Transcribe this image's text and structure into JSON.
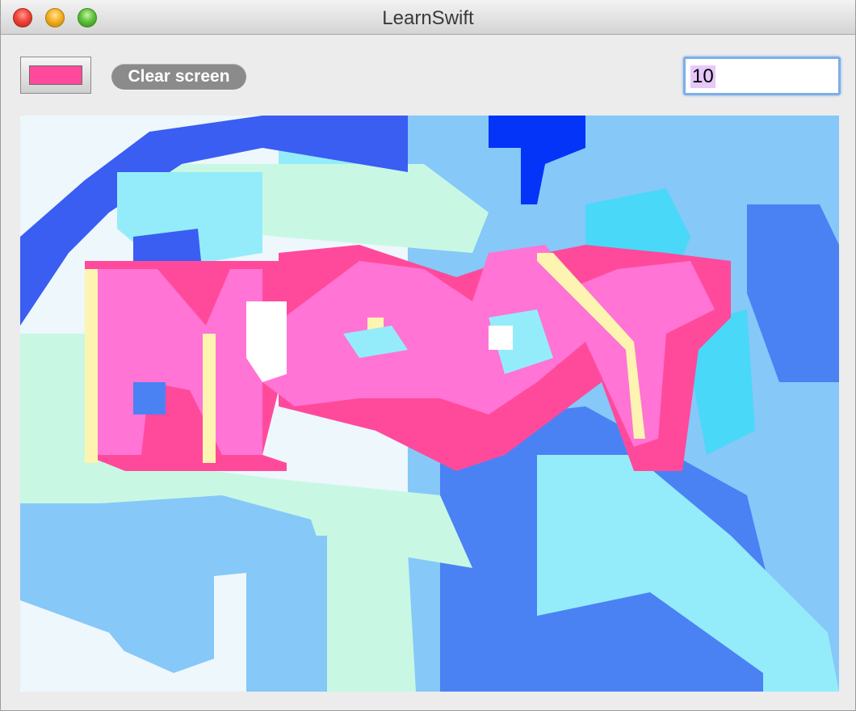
{
  "window": {
    "title": "LearnSwift"
  },
  "toolbar": {
    "color_well": {
      "selected_color": "#ff4a9c"
    },
    "clear_button_label": "Clear screen",
    "brush_size_field": {
      "value": "10"
    }
  },
  "canvas": {
    "background": "#edf7fc",
    "palette": {
      "deep_blue": "#0434f8",
      "royal_blue": "#3a5df2",
      "cornflower": "#4a82f4",
      "sky": "#86c8f8",
      "cyan": "#4ad8f8",
      "aqua": "#94ecfa",
      "mint": "#c8f8e4",
      "pale_ice": "#edf7fc",
      "white": "#ffffff",
      "hot_pink": "#ff4a9c",
      "pink": "#ff74d4",
      "cream": "#fcf4b0"
    }
  }
}
